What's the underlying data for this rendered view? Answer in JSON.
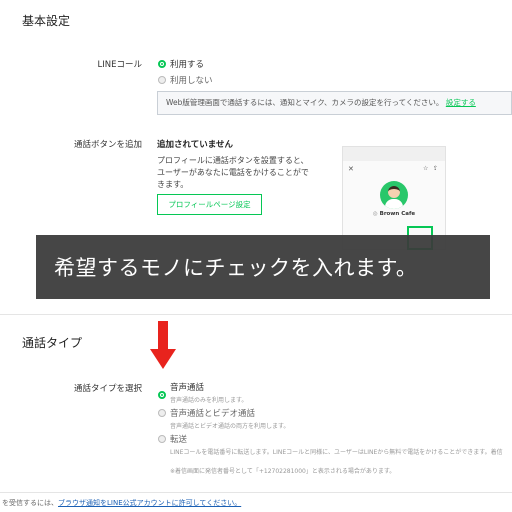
{
  "basic_settings": {
    "title": "基本設定",
    "line_call_label": "LINEコール",
    "line_call_on": "利用する",
    "line_call_off": "利用しない",
    "notice_text": "Web版管理画面で通話するには、通知とマイク、カメラの設定を行ってください。",
    "notice_link": "設定する",
    "call_button_label": "通話ボタンを追加",
    "call_button_status": "追加されていません",
    "call_button_desc_1": "プロフィールに通話ボタンを設置すると、",
    "call_button_desc_2": "ユーザーがあなたに電話をかけることがで",
    "call_button_desc_3": "きます。",
    "profile_button": "プロフィールページ設定",
    "preview_name": "Brown Cafe"
  },
  "banner": {
    "text": "希望するモノにチェックを入れます。"
  },
  "call_type": {
    "title": "通話タイプ",
    "select_label": "通話タイプを選択",
    "options": [
      {
        "label": "音声通話",
        "desc": "音声通話のみを利用します。"
      },
      {
        "label": "音声通話とビデオ通話",
        "desc": "音声通話とビデオ通話の両方を利用します。"
      },
      {
        "label": "転送",
        "desc": "LINEコールを電話番号に転送します。LINEコールと同様に、ユーザーはLINEから無料で電話をかけることができます。着信",
        "desc2": "※着信画面に発信者番号として「+12702281000」と表示される場合があります。"
      }
    ]
  },
  "footer": {
    "prefix": "を受信するには、",
    "link": "ブラウザ通知をLINE公式アカウントに許可してください。"
  },
  "colors": {
    "accent": "#06c755",
    "arrow": "#e8231d",
    "banner_bg": "#3a3a3a"
  }
}
